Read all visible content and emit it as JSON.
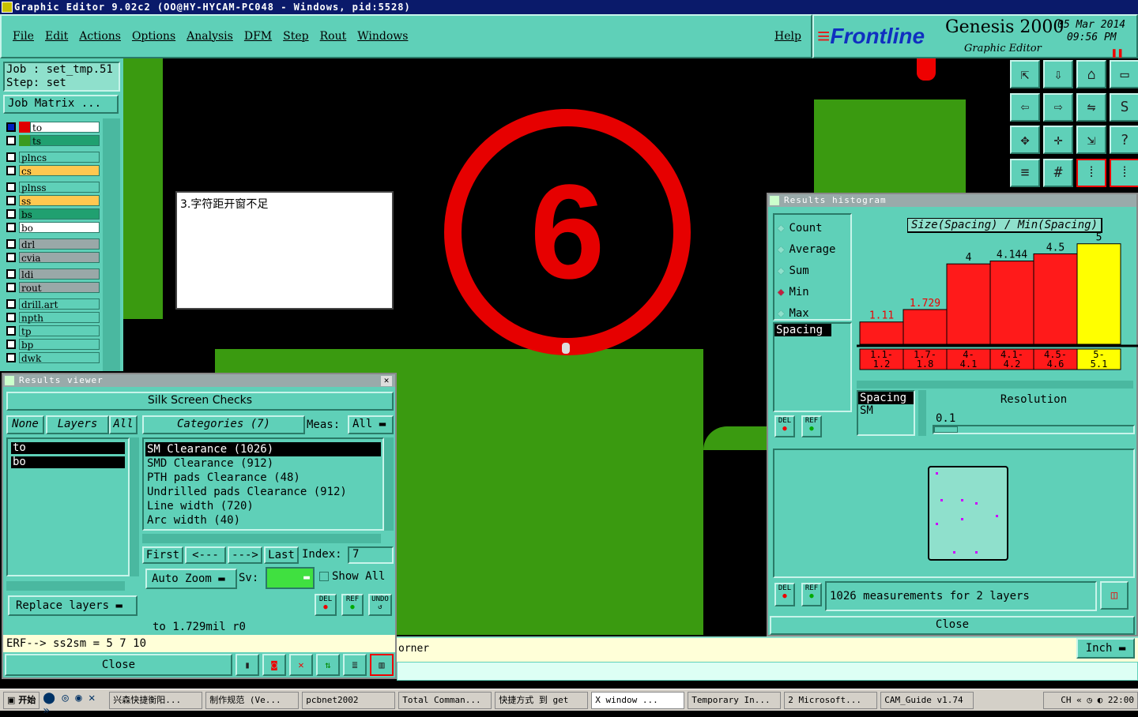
{
  "window": {
    "title": "Graphic Editor 9.02c2 (OO@HY-HYCAM-PC048 - Windows, pid:5528)"
  },
  "menu": [
    "File",
    "Edit",
    "Actions",
    "Options",
    "Analysis",
    "DFM",
    "Step",
    "Rout",
    "Windows"
  ],
  "help": "Help",
  "brand": {
    "logo": "Frontline",
    "product": "Genesis 2000",
    "subtitle": "Graphic Editor",
    "date": "05 Mar 2014",
    "time": "09:56 PM"
  },
  "job": {
    "job_line": "Job : set_tmp.51",
    "step_line": "Step: set",
    "matrix_btn": "Job Matrix ..."
  },
  "layers": [
    {
      "name": "to",
      "color": "#ffffff",
      "swatch": "#e00000"
    },
    {
      "name": "ts",
      "color": "#20a070",
      "swatch": "#3a9a20"
    },
    {
      "name": "plncs",
      "color": "#5fd0b8",
      "swatch": ""
    },
    {
      "name": "cs",
      "color": "#ffc850",
      "swatch": ""
    },
    {
      "name": "plnss",
      "color": "#5fd0b8",
      "swatch": ""
    },
    {
      "name": "ss",
      "color": "#ffc850",
      "swatch": ""
    },
    {
      "name": "bs",
      "color": "#20a070",
      "swatch": ""
    },
    {
      "name": "bo",
      "color": "#ffffff",
      "swatch": ""
    },
    {
      "name": "drl",
      "color": "#9aa8a8",
      "swatch": ""
    },
    {
      "name": "cvia",
      "color": "#9aa8a8",
      "swatch": ""
    },
    {
      "name": "ldi",
      "color": "#9aa8a8",
      "swatch": ""
    },
    {
      "name": "rout",
      "color": "#9aa8a8",
      "swatch": ""
    },
    {
      "name": "drill.art",
      "color": "#5fd0b8",
      "swatch": ""
    },
    {
      "name": "npth",
      "color": "#5fd0b8",
      "swatch": ""
    },
    {
      "name": "tp",
      "color": "#5fd0b8",
      "swatch": ""
    },
    {
      "name": "bp",
      "color": "#5fd0b8",
      "swatch": ""
    },
    {
      "name": "dwk",
      "color": "#5fd0b8",
      "swatch": ""
    }
  ],
  "note": {
    "text": "3.字符距开窗不足"
  },
  "canvas": {
    "circle_label": "6"
  },
  "results_viewer": {
    "title": "Results viewer",
    "header": "Silk Screen Checks",
    "none_btn": "None",
    "layers_lbl": "Layers",
    "all_btn": "All",
    "categories_lbl": "Categories (7)",
    "meas_lbl": "Meas:",
    "meas_val": "All",
    "layer_list": [
      "to",
      "bo"
    ],
    "categories": [
      "SM Clearance (1026)",
      "SMD Clearance (912)",
      "PTH pads Clearance (48)",
      "Undrilled pads Clearance (912)",
      "Line width (720)",
      "Arc width (40)"
    ],
    "first": "First",
    "prev": "<---",
    "next": "--->",
    "last": "Last",
    "index_lbl": "Index:",
    "index_val": "7",
    "autozoom": "Auto Zoom",
    "sv_lbl": "Sv:",
    "show_all": "Show All",
    "replace": "Replace layers",
    "del": "DEL",
    "ref": "REF",
    "undo": "UNDO",
    "status": "to 1.729mil   r0",
    "erf": "ERF--> ss2sm = 5 7 10",
    "close": "Close"
  },
  "histogram": {
    "title": "Results histogram",
    "options": [
      "Count",
      "Average",
      "Sum",
      "Min",
      "Max"
    ],
    "selected": "Min",
    "chart_title": "Size(Spacing) / Min(Spacing)",
    "field_list": [
      "Spacing"
    ],
    "type_list": [
      "Spacing",
      "SM"
    ],
    "resolution_lbl": "Resolution",
    "resolution_val": "0.1",
    "summary": "1026 measurements for 2 layers",
    "close": "Close",
    "del": "DEL",
    "ref": "REF"
  },
  "chart_data": {
    "type": "bar",
    "title": "Size(Spacing) / Min(Spacing)",
    "categories": [
      "1.1- 1.2",
      "1.7- 1.8",
      "4- 4.1",
      "4.1- 4.2",
      "4.5- 4.6",
      "5- 5.1"
    ],
    "values": [
      1.11,
      1.729,
      4,
      4.144,
      4.5,
      5
    ],
    "labels": [
      "1.11",
      "1.729",
      "4",
      "4.144",
      "4.5",
      "5"
    ],
    "colors": [
      "#ff1a1a",
      "#ff1a1a",
      "#ff1a1a",
      "#ff1a1a",
      "#ff1a1a",
      "#ffff00"
    ],
    "ylim": [
      0,
      5.5
    ]
  },
  "cmdline": {
    "text": "orner",
    "units": "Inch"
  },
  "taskbar": {
    "start": "开始",
    "items": [
      "兴森快捷衡阳...",
      "制作规范 (Ve...",
      "pcbnet2002",
      "Total Comman...",
      "快捷方式 到 get",
      "X window ...",
      "Temporary In...",
      "2 Microsoft...",
      "CAM_Guide v1.74"
    ],
    "clock": "22:00",
    "lang": "CH"
  }
}
